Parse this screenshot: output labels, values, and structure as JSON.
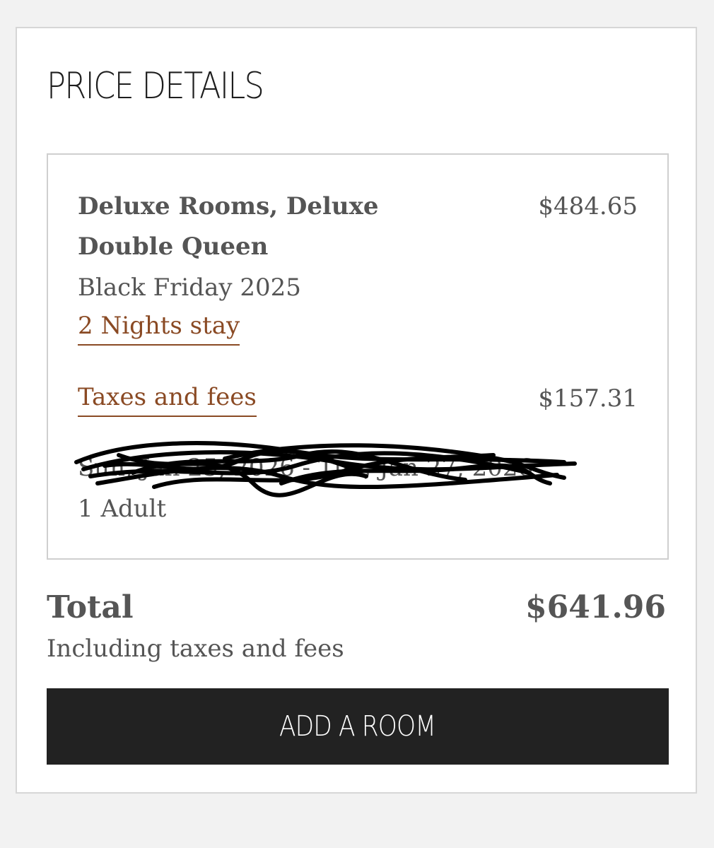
{
  "panel": {
    "title": "PRICE DETAILS"
  },
  "room": {
    "name": "Deluxe Rooms, Deluxe Double Queen",
    "price": "$484.65",
    "rate": "Black Friday 2025",
    "nights_link": "2 Nights stay"
  },
  "taxes": {
    "label": "Taxes and fees",
    "price": "$157.31"
  },
  "stay": {
    "dates_partial": "Sun, Jan 25, 2026 - Tue, Jan 27, 2026",
    "guests": "1 Adult"
  },
  "total": {
    "label": "Total",
    "value": "$641.96",
    "note": "Including taxes and fees"
  },
  "actions": {
    "add_room_label": "ADD A ROOM"
  },
  "colors": {
    "link": "#8a4a24",
    "text": "#555555",
    "button_bg": "#222222"
  }
}
